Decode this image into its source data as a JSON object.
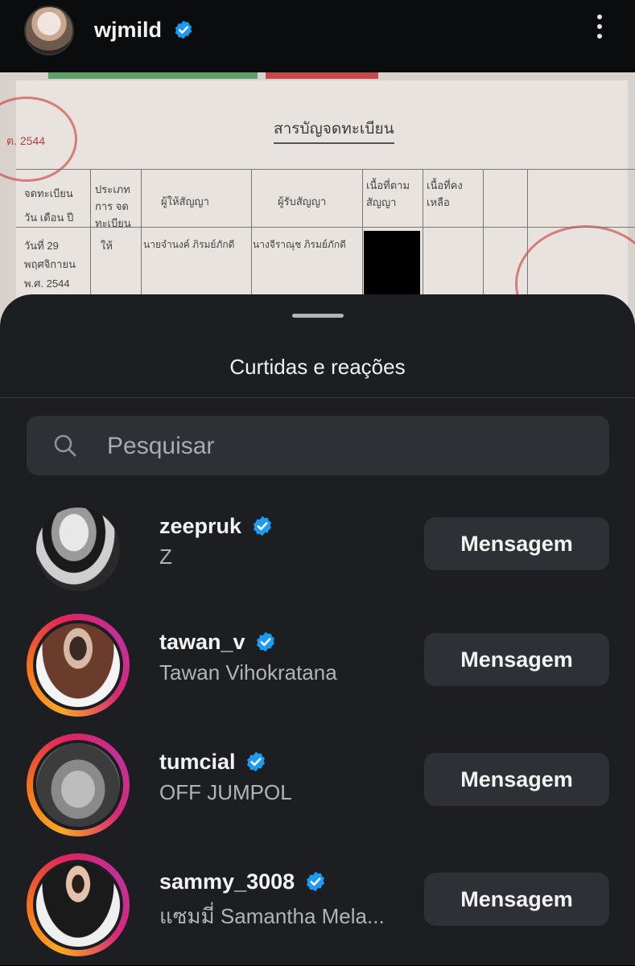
{
  "header": {
    "username": "wjmild",
    "verified_icon": "verified-badge-icon",
    "menu_icon": "more-vertical-icon"
  },
  "post_image": {
    "title": "สารบัญจดทะเบียน",
    "date_row": [
      "วันที่ 29",
      "พฤศจิกายน",
      "พ.ศ. 2544"
    ],
    "type": "ให้",
    "giver": "นายจำนงค์ ภิรมย์ภักดี",
    "receiver": "นางจีราณุช ภิรมย์ภักดี",
    "col_headers": [
      "จดทะเบียน",
      "วัน เดือน ปี",
      "ประเภท การ จดทะเบียน",
      "ผู้ให้สัญญา",
      "ผู้รับสัญญา",
      "เนื้อที่ตาม สัญญา",
      "เนื้อที่คง เหลือ"
    ],
    "stamp_text": "ต. 2544"
  },
  "sheet": {
    "title": "Curtidas e reações",
    "search": {
      "placeholder": "Pesquisar"
    },
    "likes": [
      {
        "username": "zeepruk",
        "full_name": "Z",
        "verified": true,
        "story_ring": false,
        "button": "Mensagem"
      },
      {
        "username": "tawan_v",
        "full_name": "Tawan Vihokratana",
        "verified": true,
        "story_ring": true,
        "button": "Mensagem"
      },
      {
        "username": "tumcial",
        "full_name": "OFF JUMPOL",
        "verified": true,
        "story_ring": true,
        "button": "Mensagem"
      },
      {
        "username": "sammy_3008",
        "full_name": "แซมมี่ Samantha Mela...",
        "verified": true,
        "story_ring": true,
        "button": "Mensagem"
      }
    ]
  },
  "colors": {
    "sheet_bg": "#1c1e21",
    "button_bg": "#2d3035",
    "verified_blue": "#1d9bf0",
    "secondary_text": "#b0b3b8"
  }
}
